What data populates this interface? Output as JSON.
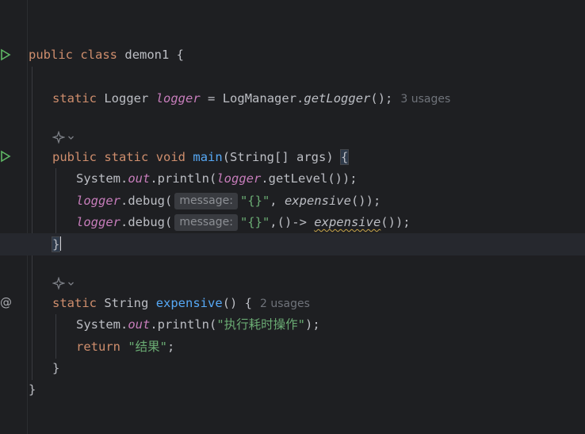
{
  "editor": {
    "lines": {
      "class_decl": {
        "kw_public": "public",
        "kw_class": "class",
        "name": "demon1 {"
      },
      "field_decl": {
        "kw_static": "static",
        "type": "Logger",
        "name": "logger",
        "eq": "=",
        "owner": "LogManager.",
        "call": "getLogger",
        "tail": "();",
        "usages": "3 usages"
      },
      "main_decl": {
        "kw_public": "public",
        "kw_static": "static",
        "kw_void": "void",
        "name": "main",
        "params": "(String[] args) ",
        "brace": "{"
      },
      "println1": {
        "prefix": "System.",
        "out": "out",
        "mid": ".println(",
        "logger": "logger",
        "tail": ".getLevel());"
      },
      "debug1": {
        "logger": "logger",
        "call": ".debug(",
        "hint": "message:",
        "str": "\"{}\"",
        "comma": ", ",
        "fn": "expensive",
        "tail": "());"
      },
      "debug2": {
        "logger": "logger",
        "call": ".debug(",
        "hint": "message:",
        "str": "\"{}\"",
        "lambda": ",()-> ",
        "fn": "expensive",
        "tail": "());"
      },
      "close_main": "}",
      "expensive_decl": {
        "kw_static": "static",
        "type": "String",
        "name": "expensive",
        "tail": "() {",
        "usages": "2 usages"
      },
      "println2": {
        "prefix": "System.",
        "out": "out",
        "mid": ".println(",
        "str": "\"执行耗时操作\"",
        "tail": ");"
      },
      "return_stmt": {
        "kw_return": "return",
        "str": "\"结果\"",
        "tail": ";"
      },
      "close_method": "}",
      "close_class": "}"
    },
    "gutter": {
      "override_marker": "@"
    }
  },
  "colors": {
    "background": "#1e1f22",
    "keyword": "#cf8e6d",
    "field": "#c77dbb",
    "function": "#56a8f5",
    "string": "#6aab73",
    "run": "#5fb865"
  }
}
